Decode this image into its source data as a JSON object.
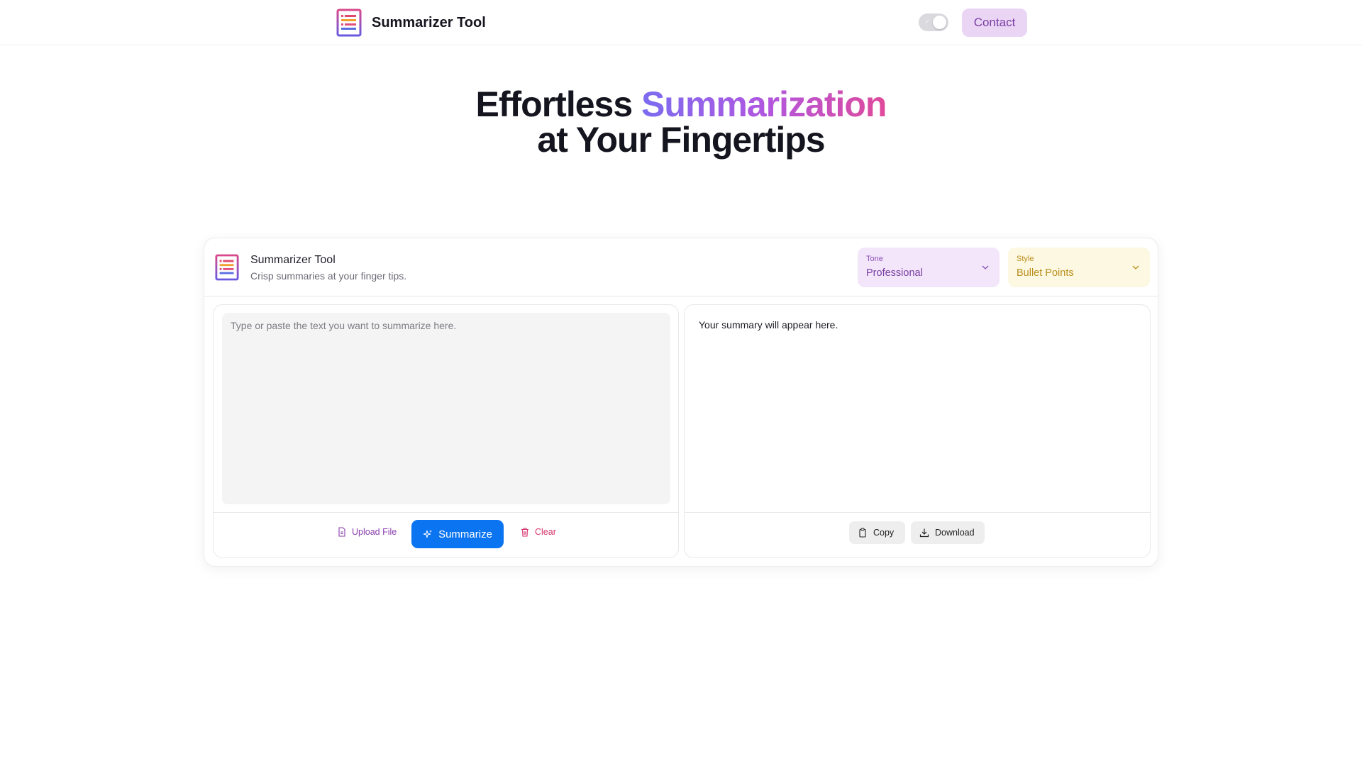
{
  "header": {
    "brand_title": "Summarizer Tool",
    "contact_label": "Contact",
    "theme_toggle_mark": "✓"
  },
  "hero": {
    "line1_plain": "Effortless ",
    "line1_highlight": "Summarization",
    "line2": "at Your Fingertips"
  },
  "card": {
    "title": "Summarizer Tool",
    "subtitle": "Crisp summaries at your finger tips.",
    "tone": {
      "label": "Tone",
      "value": "Professional"
    },
    "style": {
      "label": "Style",
      "value": "Bullet Points"
    }
  },
  "input": {
    "placeholder": "Type or paste the text you want to summarize here.",
    "upload_label": "Upload File",
    "summarize_label": "Summarize",
    "clear_label": "Clear"
  },
  "output": {
    "placeholder_text": "Your summary will appear here.",
    "copy_label": "Copy",
    "download_label": "Download"
  },
  "colors": {
    "accent_blue": "#0b74f0",
    "contact_bg": "#ead5f5",
    "tone_bg": "#f3e6fa",
    "style_bg": "#fdf8e1",
    "gradient": [
      "#7b6cf0",
      "#b057e0",
      "#e04a9a"
    ]
  },
  "icons": {
    "logo": "document-lines-logo",
    "upload": "file-icon",
    "summarize": "sparkles-icon",
    "clear": "trash-icon",
    "copy": "clipboard-icon",
    "download": "download-icon",
    "select": "chevron-down-icon"
  }
}
